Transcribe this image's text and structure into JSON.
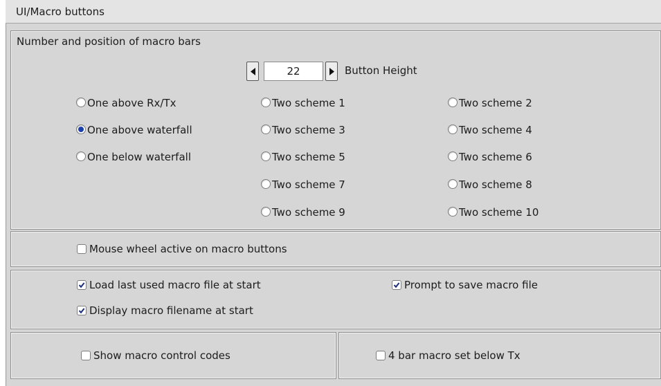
{
  "header": {
    "title": "UI/Macro buttons"
  },
  "macro_bars": {
    "group_title": "Number and position of macro bars",
    "button_height": {
      "value": "22",
      "label": "Button Height"
    },
    "options": {
      "one_above_rxtx": "One above Rx/Tx",
      "one_above_waterfall": "One above waterfall",
      "one_below_waterfall": "One below waterfall",
      "two_scheme_1": "Two scheme 1",
      "two_scheme_2": "Two scheme 2",
      "two_scheme_3": "Two scheme 3",
      "two_scheme_4": "Two scheme 4",
      "two_scheme_5": "Two scheme 5",
      "two_scheme_6": "Two scheme 6",
      "two_scheme_7": "Two scheme 7",
      "two_scheme_8": "Two scheme 8",
      "two_scheme_9": "Two scheme 9",
      "two_scheme_10": "Two scheme 10"
    },
    "selected": "One above waterfall"
  },
  "mouse_wheel": {
    "label": "Mouse wheel active on macro buttons",
    "checked": false
  },
  "file_options": {
    "load_last": {
      "label": "Load last used macro file at start",
      "checked": true
    },
    "prompt_save": {
      "label": "Prompt to save macro file",
      "checked": true
    },
    "display_filename": {
      "label": "Display macro filename at start",
      "checked": true
    }
  },
  "bottom": {
    "show_control_codes": {
      "label": "Show macro control codes",
      "checked": false
    },
    "four_bar": {
      "label": "4 bar macro set below Tx",
      "checked": false
    }
  },
  "colors": {
    "background": "#d6d6d6",
    "radio_selected": "#1a3fae",
    "check_mark": "#1a2f7a"
  }
}
